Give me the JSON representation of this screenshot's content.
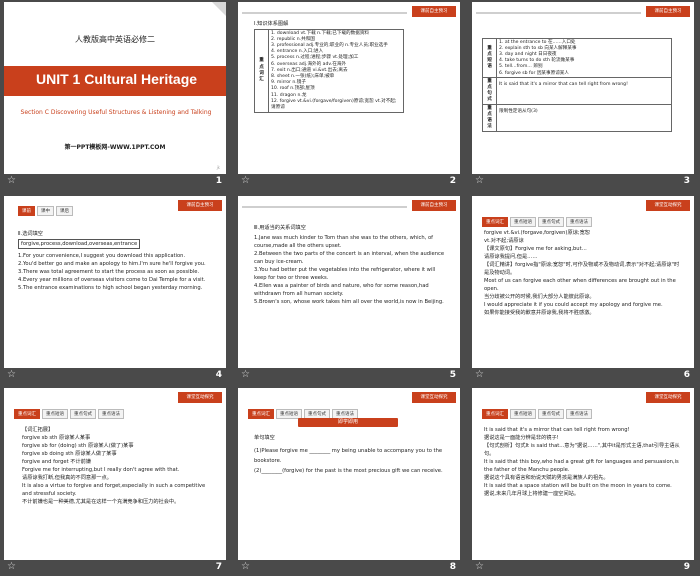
{
  "slides": [
    {
      "number": "1",
      "textbook": "人教版高中英语必修二",
      "unit_title": "UNIT 1 Cultural Heritage",
      "section": "Section C   Discovering Useful Structures & Listening and Talking",
      "footer": "第一PPT模板网-WWW.1PPT.COM",
      "watermark": "jk"
    },
    {
      "number": "2",
      "badge": "课前自主预习",
      "heading": "Ⅰ.知识体系图解",
      "side_label": "重点词汇",
      "rows": [
        "1. download vt.下载  n.下载;已下载的数据资料",
        "2. republic n.共和国",
        "3. professional adj.专业的;职业的  n.专业人员;职业选手",
        "4. entrance n.入口;进入",
        "5. process n.过程;进程;步骤  vt.处理;加工",
        "6. overseas adj.海外的  adv.在海外",
        "7. exit n.出口;通道  vi.&vt.出去;离去",
        "8. sheet n.一张(纸);床单;被单",
        "9. mirror n.镜子",
        "10. roof n.顶部;屋顶",
        "11. dragon n.龙",
        "12. forgive vt.&vi.(forgave/forgiven)原谅;宽恕  vt.对不起;请原谅"
      ]
    },
    {
      "number": "3",
      "badge": "课前自主预习",
      "side_phrase": "重点短语",
      "side_sentence": "重点句式",
      "side_grammar": "重点语法",
      "phrases": [
        "1. at the entrance to 在……入口处",
        "2. explain sth to sb 向某人解释某事",
        "3. day and night 日日夜夜",
        "4. take turns to do sth 轮流做某事",
        "5. tell…from… 辨别",
        "6. forgive sb for 因某事原谅某人"
      ],
      "sentence": "It is said that it's a mirror that can tell right from wrong!",
      "grammar": "限制性定语从句(3)"
    },
    {
      "number": "4",
      "tabs": [
        "课前",
        "课中",
        "课后"
      ],
      "badge": "课前自主预习",
      "heading": "Ⅱ.选词填空",
      "word_box": "forgive,process,download,overseas,entrance",
      "items": [
        "1.For your convenience,I suggest you download this application.",
        "2.You'd better go and make an apology to him.I'm sure he'll forgive you.",
        "3.There was total agreement to start the process as soon as possible.",
        "4.Every year millions of overseas visitors come to Dai Temple for a visit.",
        "5.The entrance examinations to high school began yesterday morning."
      ]
    },
    {
      "number": "5",
      "badge": "课前自主预习",
      "heading": "Ⅲ.用适当的关系词填空",
      "items": [
        "1.Jane was much kinder to Tom than she was to the others, which, of course,made all the others upset.",
        "2.Between the two parts of the concert is an interval, when the audience can buy ice-cream.",
        "3.You had better put the vegetables into the refrigerator, where it will keep for two or three weeks.",
        "4.Ellen was a painter of birds and nature, who for some reason,had withdrawn from all human society.",
        "5.Brown's son, whose work takes him all over the world,is now in Beijing."
      ]
    },
    {
      "number": "6",
      "tabs": [
        "重点词汇",
        "重点短语",
        "重点句式",
        "重点语法"
      ],
      "badge": "课堂互动探究",
      "lines": [
        "forgive vt.&vi.(forgave,forgiven)原谅;宽恕",
        "vt.对不起;请原谅",
        "【课文原句】Forgive me for asking,but…",
        "请原谅我提问,但是……",
        "【词汇精讲】forgive指\"原谅;宽恕\"时,可作及物或不及物动词,表示\"对不起;请原谅\"时是及物动词。",
        "Most of us can forgive each other when differences are brought out in the open.",
        "当分歧被公开的时候,我们大部分人能彼此原谅。",
        "I would appreciate it if you could accept my apology and forgive me.",
        "如果你能接受我的歉意并原谅我,我将不胜感激。"
      ]
    },
    {
      "number": "7",
      "tabs": [
        "重点词汇",
        "重点短语",
        "重点句式",
        "重点语法"
      ],
      "badge": "课堂互动探究",
      "lines": [
        "【词汇拓展】",
        "forgive sb sth 原谅某人某事",
        "forgive sb for (doing) sth 原谅某人(做了)某事",
        "forgive sb doing sth 原谅某人做了某事",
        "forgive and forget 不计前嫌",
        "Forgive me for interrupting,but I really don't agree with that.",
        "请原谅我打断,但我真的不同意那一点。",
        "It is also a virtue to forgive and forget,especially in such a competitive and stressful society.",
        "不计前嫌也是一种美德,尤其是在这样一个充满竞争和压力的社会中。"
      ]
    },
    {
      "number": "8",
      "tabs": [
        "重点词汇",
        "重点短语",
        "重点句式",
        "重点语法"
      ],
      "badge": "课堂互动探究",
      "banner": "即学即用",
      "heading": "单句填空",
      "items": [
        "(1)Please forgive me ________ my being unable to accompany you to the bookstore.",
        "(2)________(forgive) for the past is the most precious gift we can receive."
      ]
    },
    {
      "number": "9",
      "tabs": [
        "重点词汇",
        "重点短语",
        "重点句式",
        "重点语法"
      ],
      "badge": "课堂互动探究",
      "lines": [
        "It is said that it's a mirror that can tell right from wrong!",
        "据说这是一面能分辨是非的镜子!",
        "【句式剖析】句式It is said that...意为\"据说……\",其中it是形式主语,that引导主语从句。",
        "It is said that this boy,who had a great gift for languages and persuasion,is the father of the Manchu people.",
        "据说这个具有语言和劝说天赋的男孩是满族人的祖先。",
        "It is said that a space station will be built on the moon in years to come.",
        "据说,未来几年月球上将修建一座空间站。"
      ]
    }
  ]
}
